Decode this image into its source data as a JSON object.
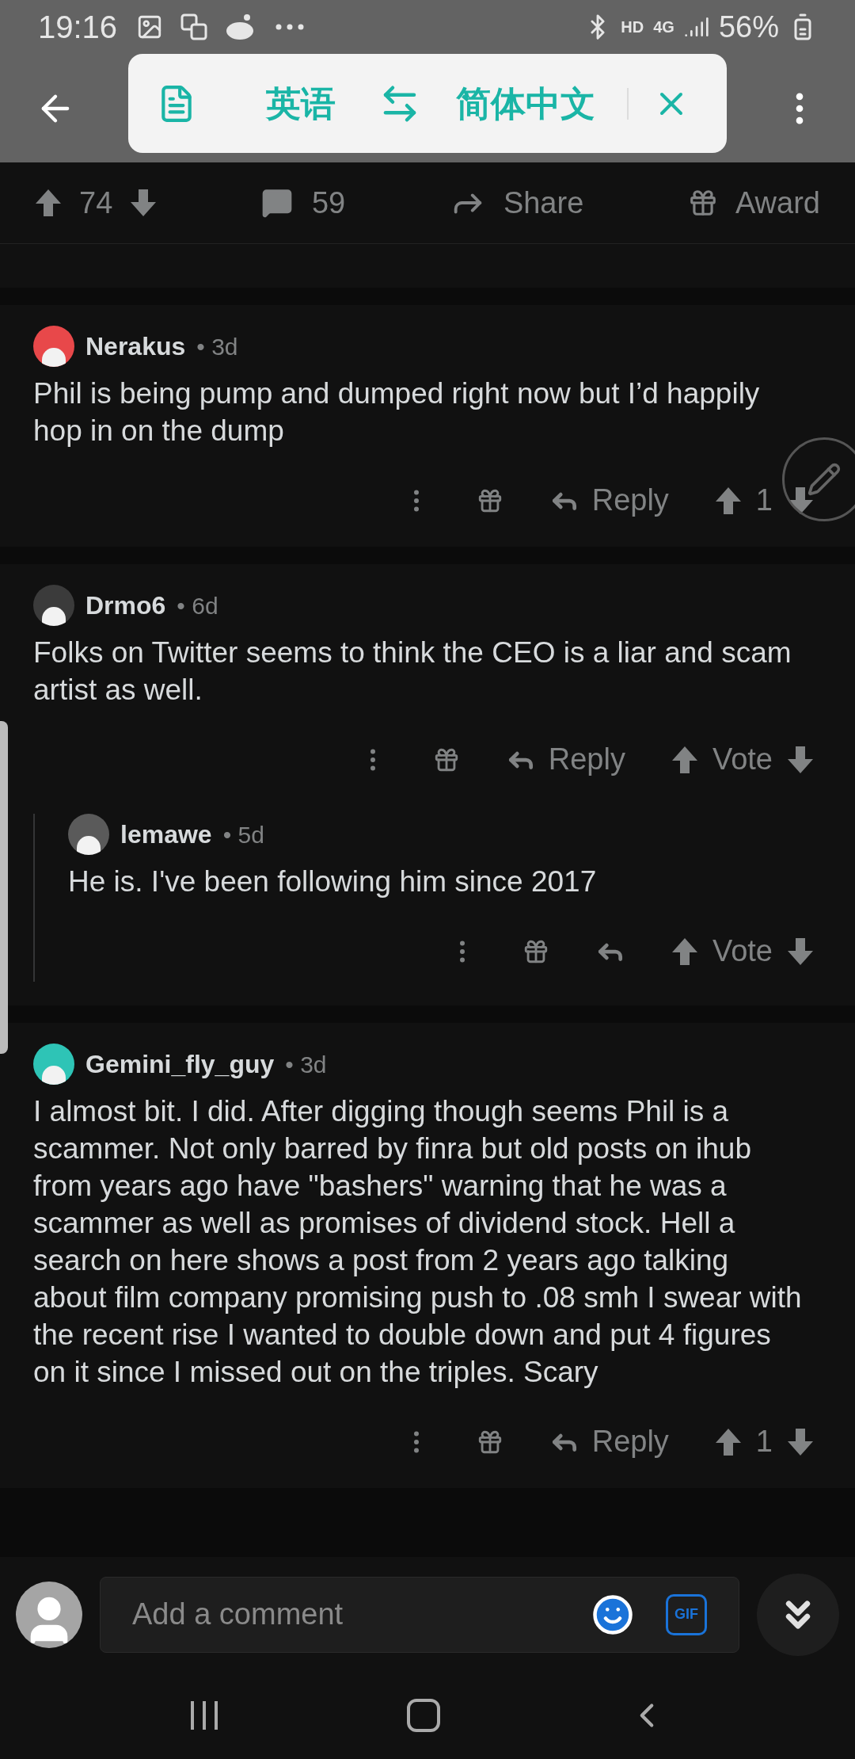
{
  "status_bar": {
    "time": "19:16",
    "hd": "HD",
    "network": "4G",
    "battery": "56%"
  },
  "translate_popup": {
    "source": "英语",
    "target": "简体中文"
  },
  "post_actions": {
    "score": "74",
    "comments": "59",
    "share": "Share",
    "award": "Award"
  },
  "comments": [
    {
      "author": "Nerakus",
      "age": "• 3d",
      "color": "#e8484a",
      "body": "Phil is being pump and dumped right now but I’d happily hop in on the dump",
      "reply_label": "Reply",
      "score": "1"
    },
    {
      "author": "Drmo6",
      "age": "• 6d",
      "color": "#3b3b3b",
      "body": "Folks on Twitter seems to think the CEO is a liar and scam artist as well.",
      "reply_label": "Reply",
      "score": "Vote",
      "replies": [
        {
          "author": "lemawe",
          "age": "• 5d",
          "color": "#5a5a5a",
          "body": "He is. I've been following him since 2017",
          "score": "Vote"
        }
      ]
    },
    {
      "author": "Gemini_fly_guy",
      "age": "• 3d",
      "color": "#2ec4b6",
      "body": "I almost bit. I did. After digging though seems Phil is a scammer. Not only barred by finra but old posts on ihub from years ago have \"bashers\" warning that he was a scammer as well as promises of dividend stock. Hell a search on here shows a post from 2 years ago talking about film company promising push to .08 smh I swear with the recent rise I wanted to double down and put 4 figures on it since I missed out on the triples. Scary",
      "reply_label": "Reply",
      "score": "1"
    }
  ],
  "comment_bar": {
    "placeholder": "Add a comment",
    "gif": "GIF"
  }
}
